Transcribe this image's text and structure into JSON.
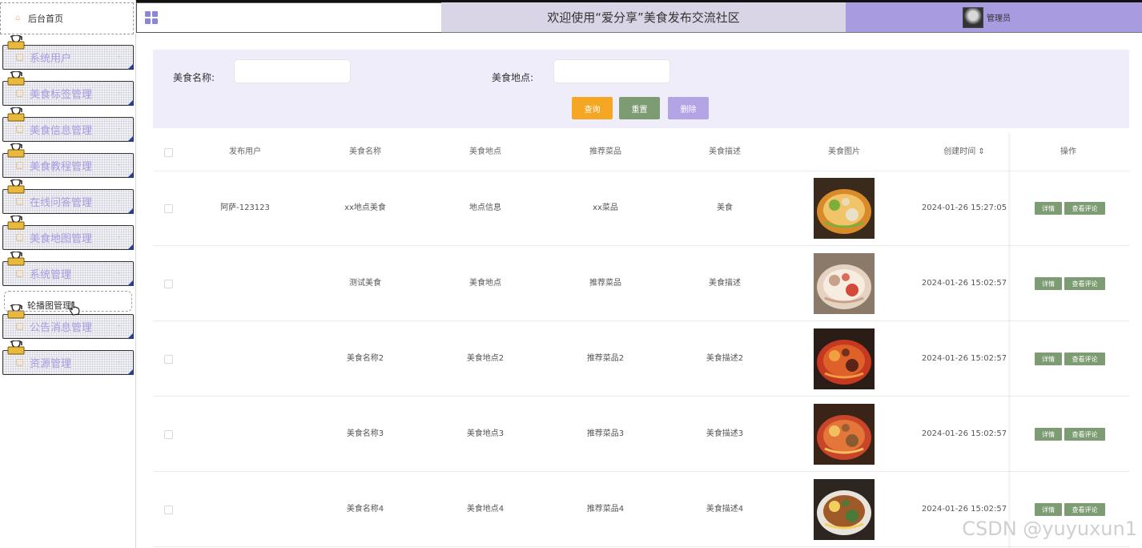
{
  "header": {
    "title": "欢迎使用“爱分享”美食发布交流社区",
    "user_name": "管理员"
  },
  "sidebar": {
    "home": "后台首页",
    "items": [
      {
        "label": "系统用户"
      },
      {
        "label": "美食标签管理"
      },
      {
        "label": "美食信息管理"
      },
      {
        "label": "美食教程管理"
      },
      {
        "label": "在线问答管理"
      },
      {
        "label": "美食地图管理"
      },
      {
        "label": "系统管理"
      },
      {
        "label": "公告消息管理"
      },
      {
        "label": "资源管理"
      }
    ],
    "sub_item": "轮播图管理"
  },
  "search": {
    "name_label": "美食名称:",
    "location_label": "美食地点:",
    "query_button": "查询",
    "reset_button": "重置",
    "delete_button": "删除"
  },
  "table": {
    "columns": [
      "发布用户",
      "美食名称",
      "美食地点",
      "推荐菜品",
      "美食描述",
      "美食图片",
      "创建时间 ⇕",
      "操作"
    ],
    "detail_button": "详情",
    "comment_button": "查看评论",
    "rows": [
      {
        "user": "阿萨-123123",
        "name": "xx地点美食",
        "location": "地点信息",
        "dish": "xx菜品",
        "desc": "美食",
        "time": "2024-01-26 15:27:05"
      },
      {
        "user": "",
        "name": "测试美食",
        "location": "美食地点",
        "dish": "推荐菜品",
        "desc": "美食描述",
        "time": "2024-01-26 15:02:57"
      },
      {
        "user": "",
        "name": "美食名称2",
        "location": "美食地点2",
        "dish": "推荐菜品2",
        "desc": "美食描述2",
        "time": "2024-01-26 15:02:57"
      },
      {
        "user": "",
        "name": "美食名称3",
        "location": "美食地点3",
        "dish": "推荐菜品3",
        "desc": "美食描述3",
        "time": "2024-01-26 15:02:57"
      },
      {
        "user": "",
        "name": "美食名称4",
        "location": "美食地点4",
        "dish": "推荐菜品4",
        "desc": "美食描述4",
        "time": "2024-01-26 15:02:57"
      }
    ]
  },
  "watermark": "CSDN @yuyuxun1",
  "colors": {
    "query": "#f5a623",
    "reset": "#7d9c73",
    "delete": "#b3a4e6",
    "title_bar": "#d9d4e6",
    "user_bar": "#a89be0",
    "panel": "#efedf9"
  }
}
